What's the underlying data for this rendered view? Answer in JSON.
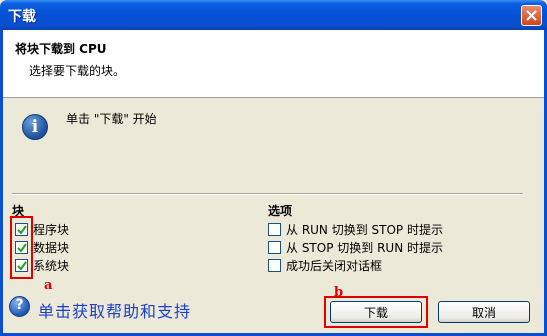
{
  "window": {
    "title": "下载"
  },
  "header": {
    "title": "将块下载到 CPU",
    "subtitle": "选择要下载的块。"
  },
  "info": {
    "text": "单击 \"下载\" 开始"
  },
  "blocks": {
    "label": "块",
    "items": [
      {
        "label": "程序块",
        "checked": true
      },
      {
        "label": "数据块",
        "checked": true
      },
      {
        "label": "系统块",
        "checked": true
      }
    ]
  },
  "options": {
    "label": "选项",
    "items": [
      {
        "label": "从 RUN 切换到 STOP 时提示",
        "checked": false
      },
      {
        "label": "从 STOP 切换到 RUN 时提示",
        "checked": false
      },
      {
        "label": "成功后关闭对话框",
        "checked": false
      }
    ]
  },
  "annotations": {
    "a": "a",
    "b": "b"
  },
  "help": {
    "text": "单击获取帮助和支持"
  },
  "buttons": {
    "download": "下载",
    "cancel": "取消"
  },
  "colors": {
    "titlebar": "#0551d6",
    "highlight": "#e00000",
    "help_text": "#1a3fc8"
  }
}
